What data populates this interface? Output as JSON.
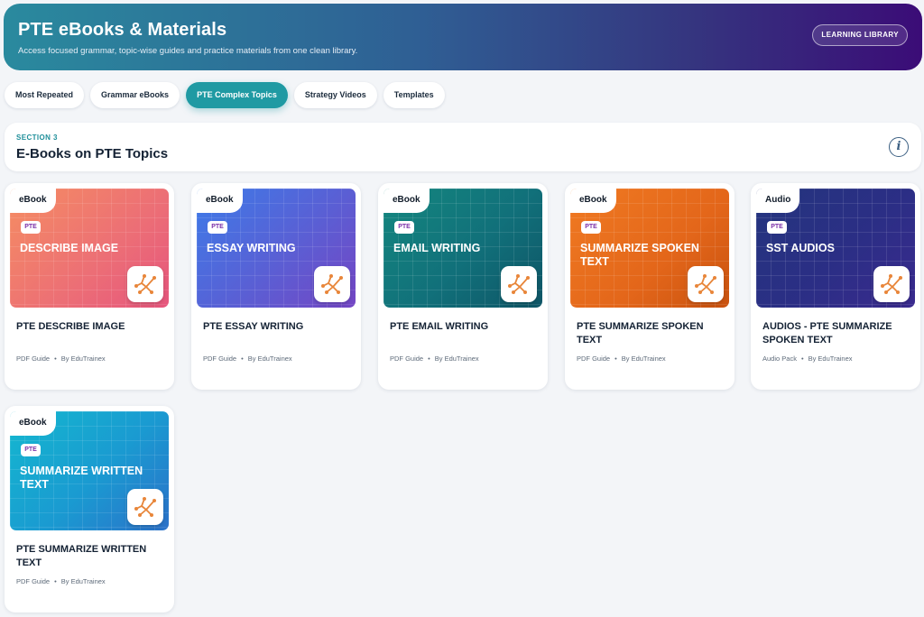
{
  "hero": {
    "title": "PTE eBooks & Materials",
    "subtitle": "Access focused grammar, topic-wise guides and practice materials from one clean library.",
    "button": "LEARNING LIBRARY"
  },
  "tabs": [
    {
      "label": "Most Repeated",
      "active": false
    },
    {
      "label": "Grammar eBooks",
      "active": false
    },
    {
      "label": "PTE Complex Topics",
      "active": true
    },
    {
      "label": "Strategy Videos",
      "active": false
    },
    {
      "label": "Templates",
      "active": false
    }
  ],
  "section": {
    "kicker": "SECTION 3",
    "title": "E-Books on PTE Topics",
    "info_icon": "info-icon"
  },
  "cards": [
    {
      "ribbon": "eBook",
      "pill": "PTE",
      "thumb_title": "DESCRIBE IMAGE",
      "title": "PTE DESCRIBE IMAGE",
      "type": "PDF Guide",
      "author": "By EduTrainex",
      "gradient": "coral"
    },
    {
      "ribbon": "eBook",
      "pill": "PTE",
      "thumb_title": "ESSAY WRITING",
      "title": "PTE ESSAY WRITING",
      "type": "PDF Guide",
      "author": "By EduTrainex",
      "gradient": "blue"
    },
    {
      "ribbon": "eBook",
      "pill": "PTE",
      "thumb_title": "EMAIL WRITING",
      "title": "PTE EMAIL WRITING",
      "type": "PDF Guide",
      "author": "By EduTrainex",
      "gradient": "teal"
    },
    {
      "ribbon": "eBook",
      "pill": "PTE",
      "thumb_title": "SUMMARIZE SPOKEN TEXT",
      "title": "PTE SUMMARIZE SPOKEN TEXT",
      "type": "PDF Guide",
      "author": "By EduTrainex",
      "gradient": "orange"
    },
    {
      "ribbon": "Audio",
      "pill": "PTE",
      "thumb_title": "SST AUDIOS",
      "title": "AUDIOS - PTE SUMMARIZE SPOKEN TEXT",
      "type": "Audio Pack",
      "author": "By EduTrainex",
      "gradient": "navy"
    },
    {
      "ribbon": "eBook",
      "pill": "PTE",
      "thumb_title": "SUMMARIZE WRITTEN TEXT",
      "title": "PTE SUMMARIZE WRITTEN TEXT",
      "type": "PDF Guide",
      "author": "By EduTrainex",
      "gradient": "cyan"
    }
  ],
  "logo_icon": "edutrainex-logo-icon",
  "colors": {
    "accent": "#1f9aa3",
    "hero_start": "#2a8a9e",
    "hero_end": "#3b0c77",
    "logo": "#e8863a"
  }
}
